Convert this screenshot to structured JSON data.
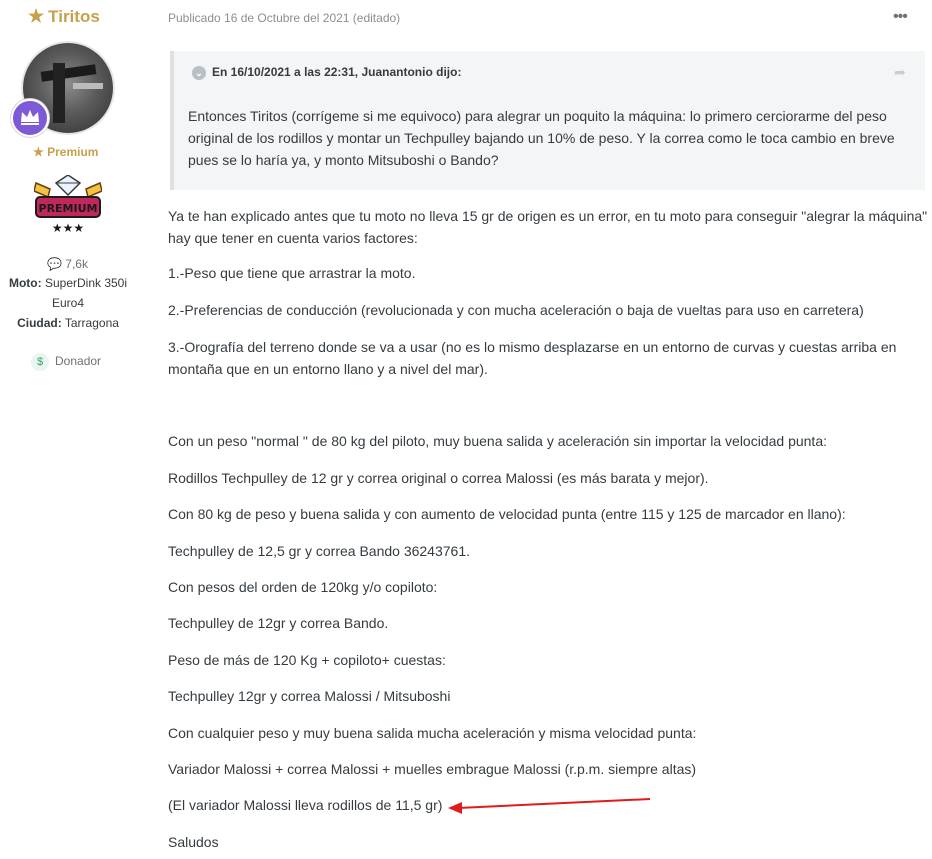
{
  "author": {
    "name": "Tiritos",
    "rank": "Premium",
    "badge_text": "PREMIUM",
    "posts": "7,6k",
    "moto_label": "Moto:",
    "moto_value_line1": "SuperDink 350i",
    "moto_value_line2": "Euro4",
    "city_label": "Ciudad:",
    "city_value": "Tarragona",
    "donor": "Donador"
  },
  "post": {
    "meta": "Publicado 16 de Octubre del 2021 (editado)",
    "quote_header": "En 16/10/2021 a las 22:31, Juanantonio dijo:",
    "quote_body": "Entonces Tiritos (corrígeme si me equivoco) para alegrar un poquito la máquina: lo primero cerciorarme del peso original de los rodillos y montar un Techpulley bajando un 10% de peso. Y la correa como le toca cambio en breve pues se lo haría ya, y monto Mitsuboshi o Bando?",
    "paragraphs": [
      "Ya te han explicado antes que tu moto no lleva 15 gr de origen es un error, en tu moto  para conseguir \"alegrar la máquina\" hay que tener en cuenta varios factores:",
      "1.-Peso que tiene que arrastrar la moto.",
      "2.-Preferencias de conducción (revolucionada y con mucha aceleración o baja de vueltas para uso en carretera)",
      "3.-Orografía del terreno donde se va a usar (no es lo mismo desplazarse en un entorno de curvas y cuestas arriba en montaña que en un entorno llano y a nivel del mar).",
      "Con un peso \"normal \" de 80 kg del piloto, muy buena salida y aceleración sin importar la velocidad punta:",
      "Rodillos Techpulley de 12 gr y correa original o correa Malossi (es más barata y mejor).",
      "Con  80 kg de peso y buena salida y con aumento de velocidad punta (entre 115 y 125 de marcador en llano):",
      "Techpulley de 12,5 gr y correa Bando 36243761.",
      "Con pesos del orden de 120kg y/o copiloto:",
      "Techpulley de 12gr y correa Bando.",
      "Peso de más de 120 Kg + copiloto+ cuestas:",
      "Techpulley 12gr y correa Malossi / Mitsuboshi",
      "Con cualquier peso y muy buena salida mucha aceleración y misma velocidad punta:",
      "Variador Malossi + correa Malossi + muelles embrague Malossi (r.p.m. siempre altas)",
      "(El variador Malossi lleva rodillos de 11,5 gr)",
      "Saludos"
    ]
  },
  "colors": {
    "accent_gold": "#c8a04b",
    "rank_purple": "#7d5bd6",
    "arrow_red": "#e01b1b"
  }
}
